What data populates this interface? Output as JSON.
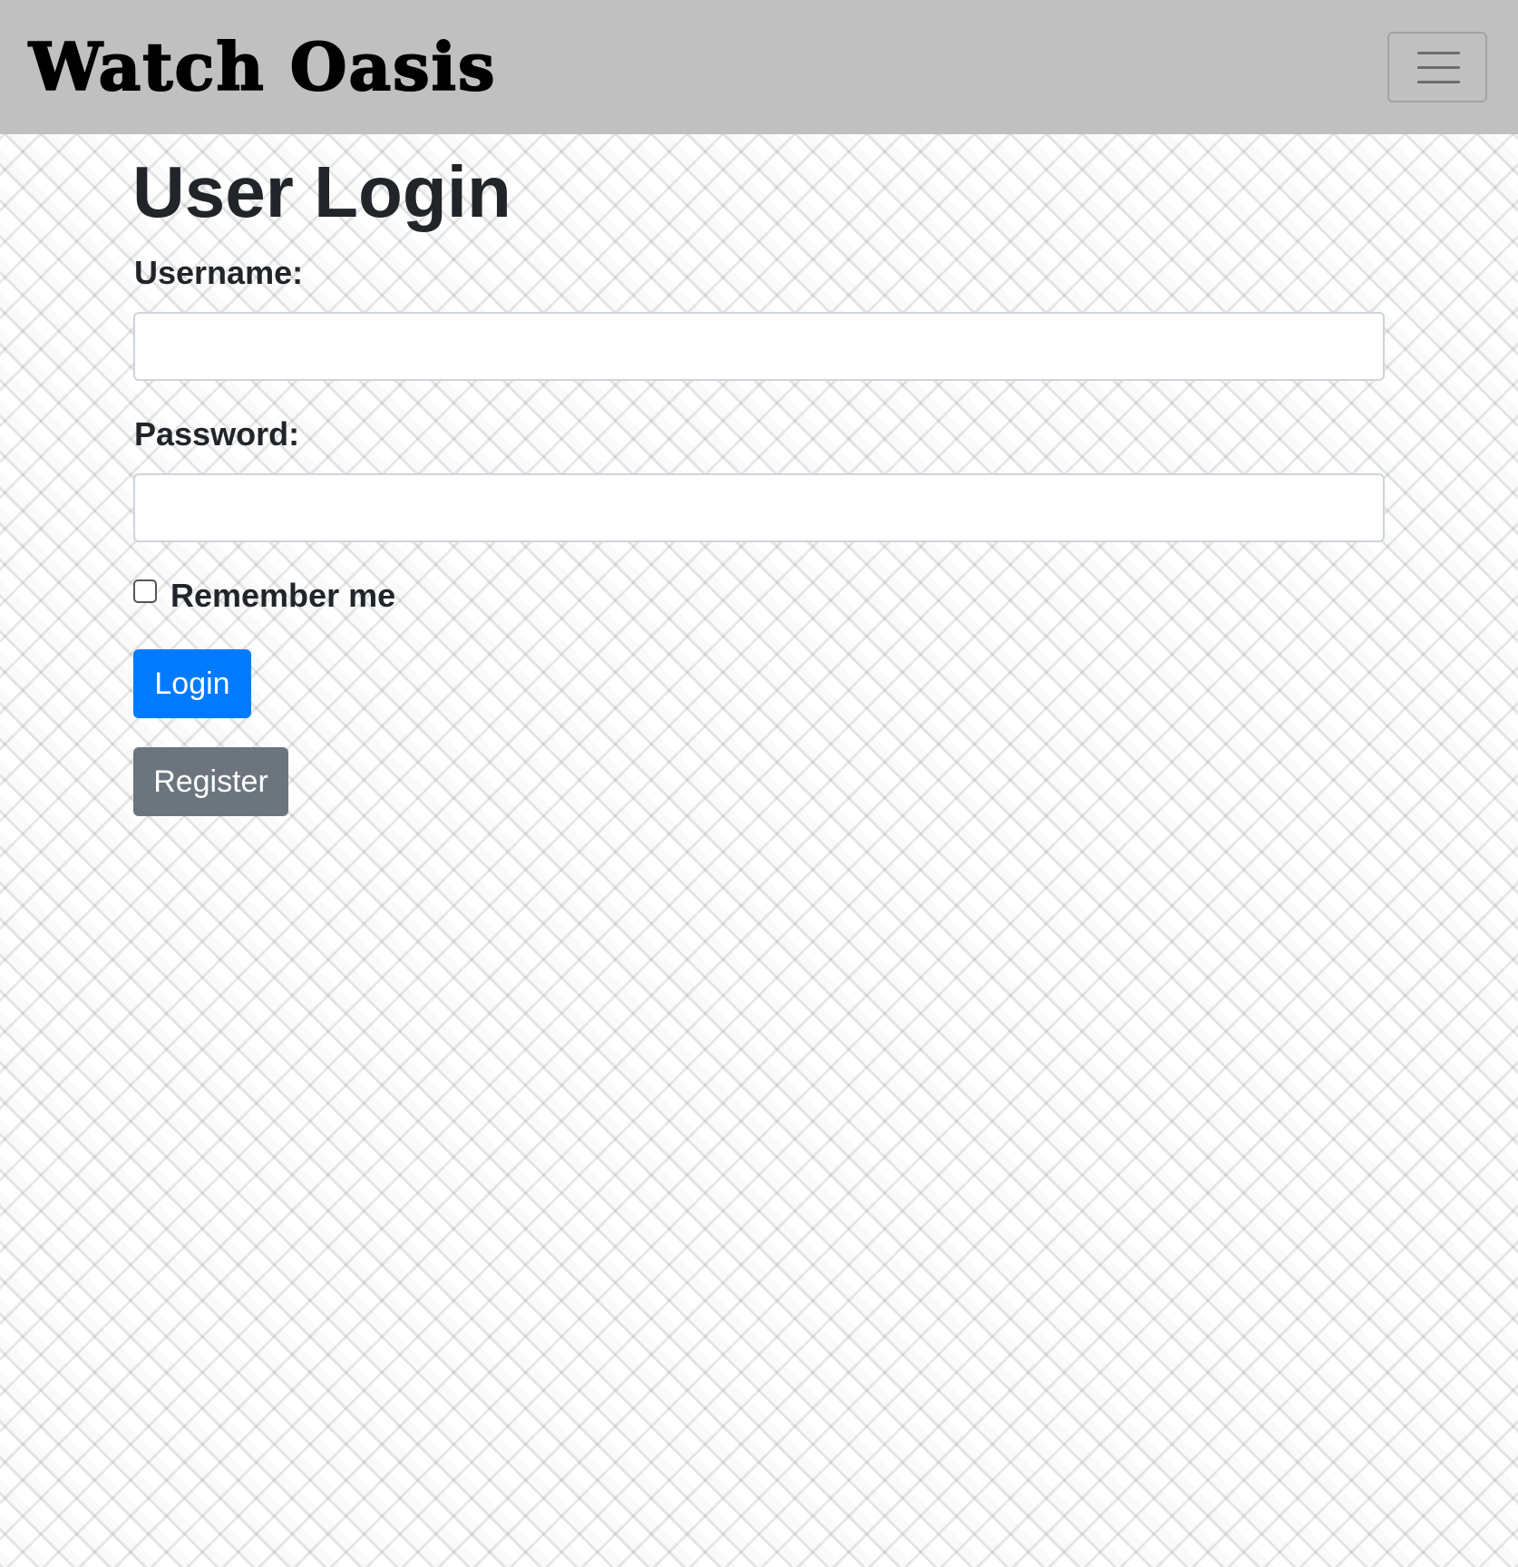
{
  "navbar": {
    "brand": "Watch Oasis",
    "toggler_icon": "hamburger-menu-icon"
  },
  "page": {
    "title": "User Login"
  },
  "form": {
    "username_label": "Username:",
    "username_value": "",
    "password_label": "Password:",
    "password_value": "",
    "remember_label": "Remember me",
    "remember_checked": false,
    "login_button": "Login",
    "register_button": "Register"
  },
  "colors": {
    "navbar_bg": "#c0c0c0",
    "primary": "#007bff",
    "secondary": "#6c757d",
    "text": "#212529"
  }
}
